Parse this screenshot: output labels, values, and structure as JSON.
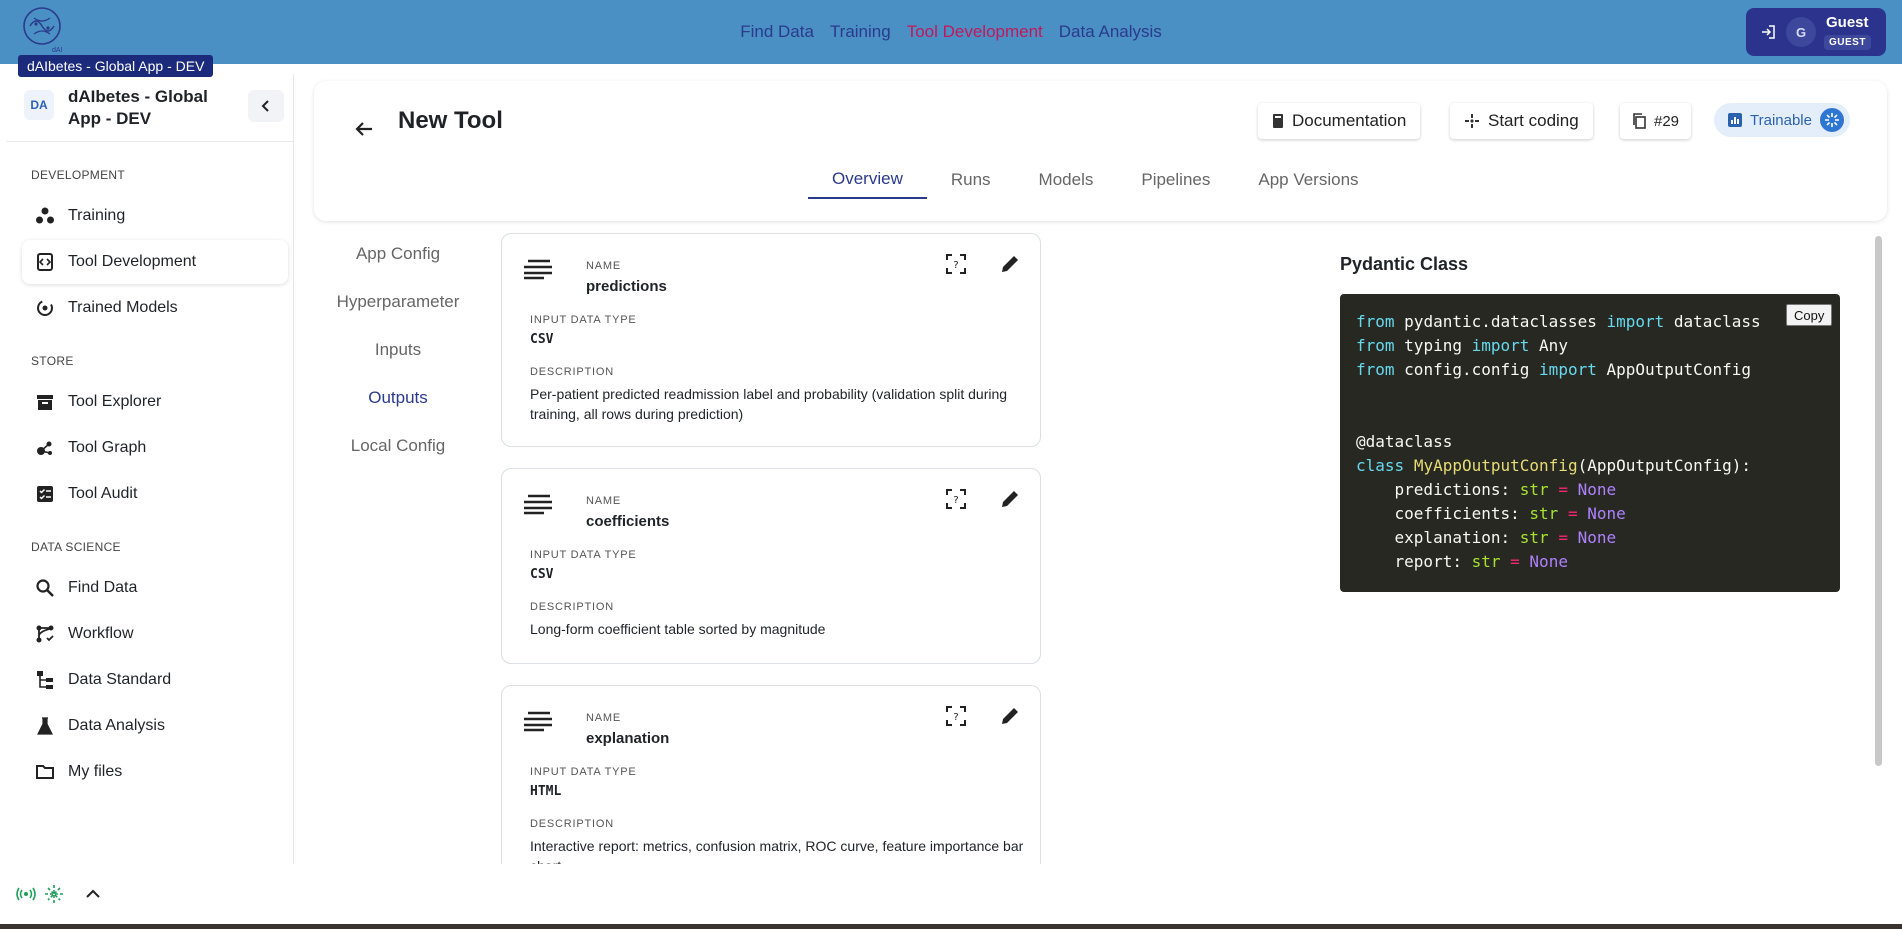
{
  "top_nav": {
    "items": [
      "Find Data",
      "Training",
      "Tool Development",
      "Data Analysis"
    ],
    "active": "Tool Development"
  },
  "user": {
    "name": "Guest",
    "role": "GUEST",
    "avatar_initial": "G"
  },
  "tooltip": "dAIbetes - Global App - DEV",
  "workspace": {
    "badge": "DA",
    "name": "dAIbetes - Global App - DEV"
  },
  "sidebar": {
    "sections": [
      {
        "title": "DEVELOPMENT",
        "items": [
          "Training",
          "Tool Development",
          "Trained Models"
        ]
      },
      {
        "title": "STORE",
        "items": [
          "Tool Explorer",
          "Tool Graph",
          "Tool Audit"
        ]
      },
      {
        "title": "DATA SCIENCE",
        "items": [
          "Find Data",
          "Workflow",
          "Data Standard",
          "Data Analysis",
          "My files"
        ]
      }
    ],
    "active": "Tool Development"
  },
  "tool": {
    "title": "New Tool",
    "documentation_label": "Documentation",
    "start_coding_label": "Start coding",
    "id_label": "#29",
    "trainable_label": "Trainable"
  },
  "tabs": {
    "items": [
      "Overview",
      "Runs",
      "Models",
      "Pipelines",
      "App Versions"
    ],
    "active": "Overview"
  },
  "subnav": {
    "items": [
      "App Config",
      "Hyperparameter",
      "Inputs",
      "Outputs",
      "Local Config"
    ],
    "active": "Outputs"
  },
  "labels": {
    "name": "NAME",
    "input_data_type": "INPUT DATA TYPE",
    "description": "DESCRIPTION"
  },
  "outputs": [
    {
      "name": "predictions",
      "type": "CSV",
      "description": "Per-patient predicted readmission label and probability (validation split during training, all rows during prediction)"
    },
    {
      "name": "coefficients",
      "type": "CSV",
      "description": "Long-form coefficient table sorted by magnitude"
    },
    {
      "name": "explanation",
      "type": "HTML",
      "description": "Interactive report: metrics, confusion matrix, ROC curve, feature importance bar chart"
    }
  ],
  "pydantic": {
    "title": "Pydantic Class",
    "copy_label": "Copy",
    "imports": [
      {
        "from": "from",
        "module": "pydantic.dataclasses",
        "imp": "import",
        "name": "dataclass"
      },
      {
        "from": "from",
        "module": "typing",
        "imp": "import",
        "name": "Any"
      },
      {
        "from": "from",
        "module": "config.config",
        "imp": "import",
        "name": "AppOutputConfig"
      }
    ],
    "decorator": "@dataclass",
    "class_kw": "class",
    "class_name": "MyAppOutputConfig",
    "base": "(AppOutputConfig):",
    "fields": [
      "predictions",
      "coefficients",
      "explanation",
      "report"
    ],
    "field_type": "str",
    "field_default": "None"
  }
}
